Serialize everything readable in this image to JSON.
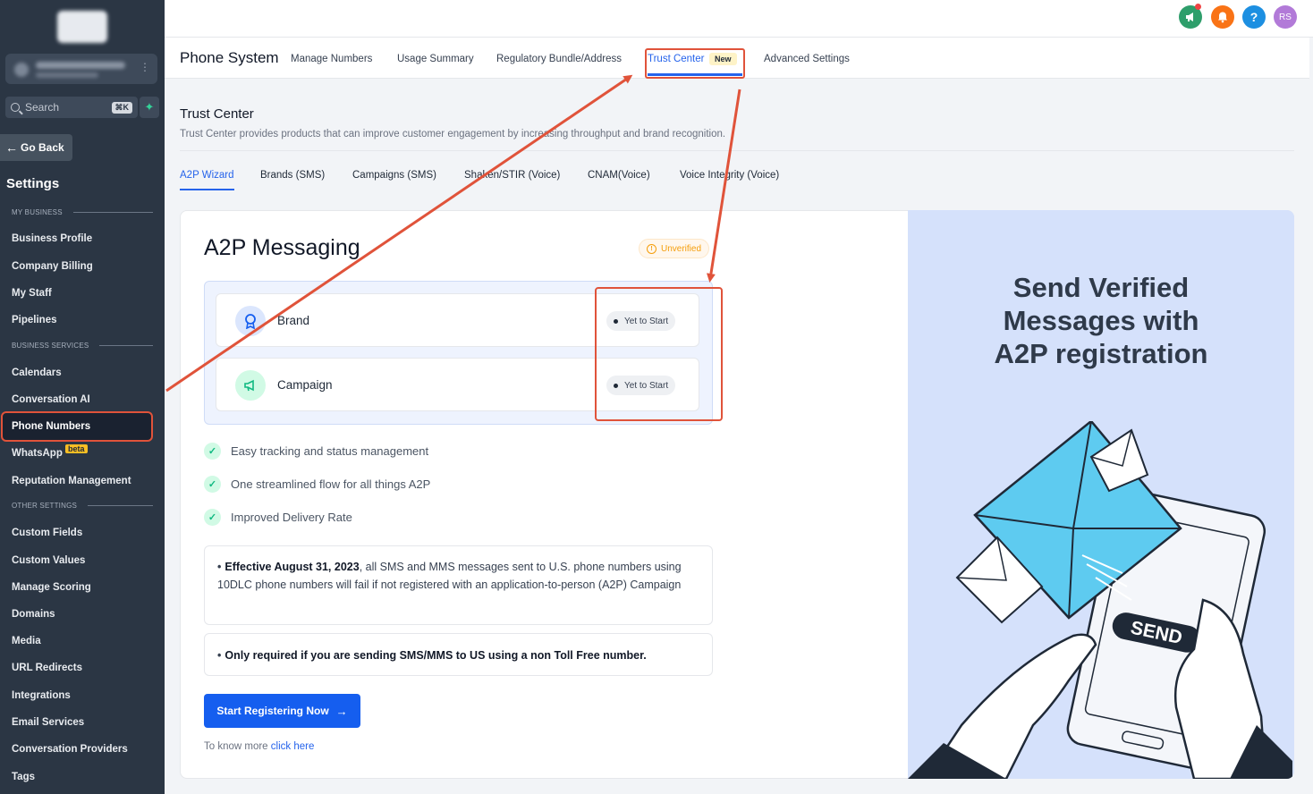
{
  "sidebar": {
    "search_placeholder": "Search",
    "search_shortcut": "⌘K",
    "go_back": "Go Back",
    "title": "Settings",
    "sections": {
      "my_business": "MY BUSINESS",
      "business_services": "BUSINESS SERVICES",
      "other_settings": "OTHER SETTINGS"
    },
    "items": {
      "business_profile": "Business Profile",
      "company_billing": "Company Billing",
      "my_staff": "My Staff",
      "pipelines": "Pipelines",
      "calendars": "Calendars",
      "conversation_ai": "Conversation AI",
      "phone_numbers": "Phone Numbers",
      "whatsapp": "WhatsApp",
      "whatsapp_badge": "beta",
      "reputation_management": "Reputation Management",
      "custom_fields": "Custom Fields",
      "custom_values": "Custom Values",
      "manage_scoring": "Manage Scoring",
      "domains": "Domains",
      "media": "Media",
      "url_redirects": "URL Redirects",
      "integrations": "Integrations",
      "email_services": "Email Services",
      "conversation_providers": "Conversation Providers",
      "tags": "Tags"
    },
    "active_item": "Phone Numbers"
  },
  "topbar": {
    "avatar_initials": "RS",
    "help_label": "?",
    "colors": {
      "announce": "#2e9e6b",
      "bell": "#f97316",
      "help": "#1d8fe1",
      "avatar": "#b27ad8"
    }
  },
  "subnav": {
    "title": "Phone System",
    "tabs": {
      "manage_numbers": "Manage Numbers",
      "usage_summary": "Usage Summary",
      "regulatory": "Regulatory Bundle/Address",
      "trust_center": "Trust Center",
      "trust_center_badge": "New",
      "advanced_settings": "Advanced Settings"
    },
    "active_tab": "Trust Center"
  },
  "trust_center": {
    "title": "Trust Center",
    "description": "Trust Center provides products that can improve customer engagement by increasing throughput and brand recognition.",
    "tabs": {
      "a2p_wizard": "A2P Wizard",
      "brands": "Brands (SMS)",
      "campaigns": "Campaigns (SMS)",
      "shaken": "Shaken/STIR (Voice)",
      "cnam": "CNAM(Voice)",
      "voice_integrity": "Voice Integrity (Voice)"
    },
    "active_tab": "A2P Wizard"
  },
  "a2p": {
    "title": "A2P Messaging",
    "status": "Unverified",
    "steps": {
      "brand": {
        "label": "Brand",
        "status": "Yet to Start"
      },
      "campaign": {
        "label": "Campaign",
        "status": "Yet to Start"
      }
    },
    "features": {
      "f1": "Easy tracking and status management",
      "f2": "One streamlined flow for all things A2P",
      "f3": "Improved Delivery Rate"
    },
    "notice1": {
      "bold": "Effective August 31, 2023",
      "rest": ", all SMS and MMS messages sent to U.S. phone numbers using 10DLC phone numbers will fail if not registered with an application-to-person (A2P) Campaign"
    },
    "notice2": "Only required if you are sending SMS/MMS to US using a non Toll Free number.",
    "cta": "Start Registering Now",
    "more_prefix": "To know more",
    "more_link": "click here"
  },
  "promo": {
    "title_line1": "Send Verified",
    "title_line2": "Messages with",
    "title_line3": "A2P registration",
    "send_label": "SEND"
  },
  "annotation_color": "#e0533a"
}
